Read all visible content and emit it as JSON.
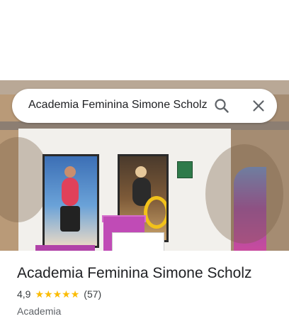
{
  "search": {
    "query": "Academia Feminina Simone Scholz"
  },
  "place": {
    "name": "Academia Feminina Simone Scholz",
    "rating": "4,9",
    "stars": 5,
    "review_count": "(57)",
    "category": "Academia"
  },
  "icons": {
    "search": "search-icon",
    "close": "close-icon",
    "star": "star-icon"
  },
  "colors": {
    "star": "#fbbc04",
    "title_text": "#202124",
    "secondary_text": "#5f6368"
  }
}
